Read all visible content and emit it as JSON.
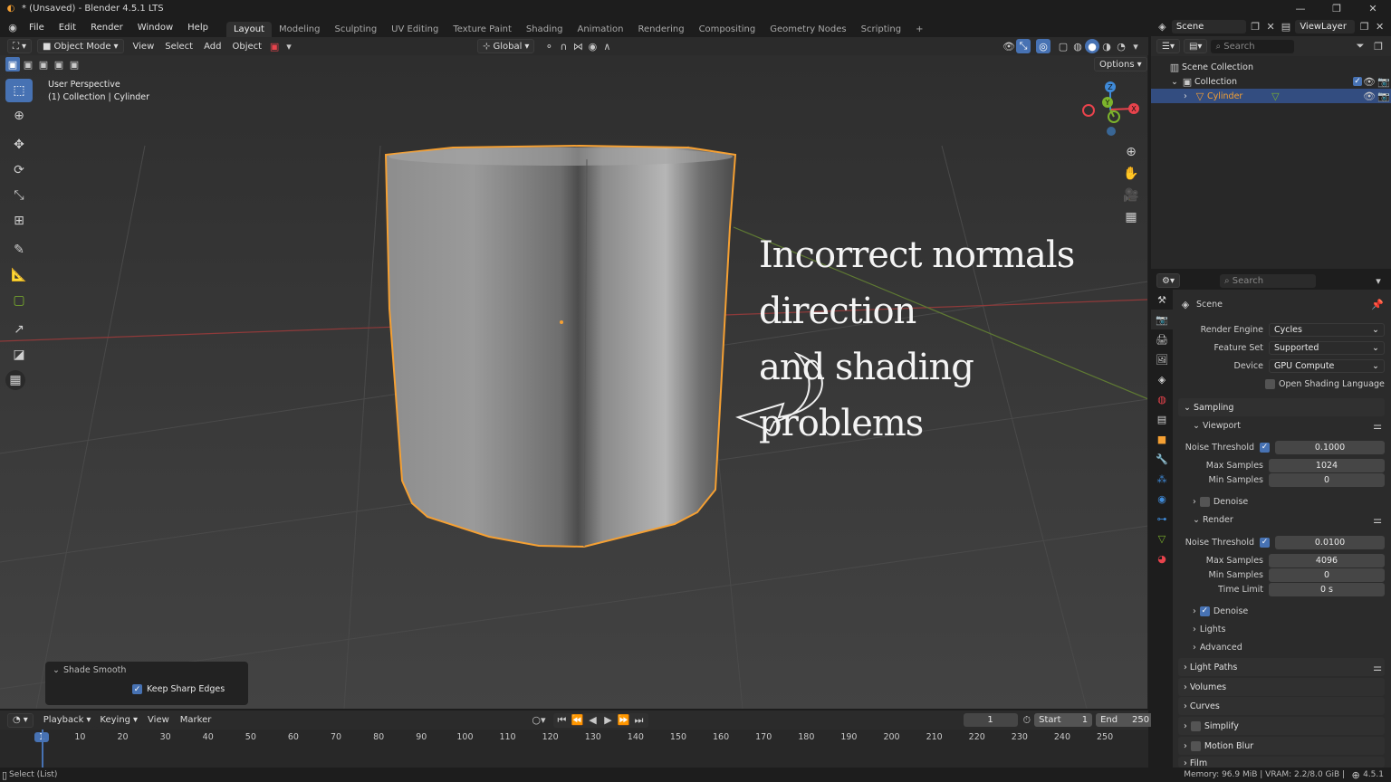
{
  "titlebar": {
    "title": "* (Unsaved) - Blender 4.5.1 LTS"
  },
  "menu": [
    "File",
    "Edit",
    "Render",
    "Window",
    "Help"
  ],
  "workspaces": [
    "Layout",
    "Modeling",
    "Sculpting",
    "UV Editing",
    "Texture Paint",
    "Shading",
    "Animation",
    "Rendering",
    "Compositing",
    "Geometry Nodes",
    "Scripting"
  ],
  "active_workspace": "Layout",
  "scene_selector": {
    "scene": "Scene",
    "view_layer": "ViewLayer"
  },
  "viewport_header": {
    "mode": "Object Mode",
    "menus": [
      "View",
      "Select",
      "Add",
      "Object"
    ],
    "orientation": "Global",
    "options": "Options"
  },
  "viewport": {
    "perspective": "User Perspective",
    "context": "(1) Collection | Cylinder",
    "annotation_line1": "Incorrect normals direction",
    "annotation_line2": "and shading problems"
  },
  "operator_panel": {
    "title": "Shade Smooth",
    "option_label": "Keep Sharp Edges",
    "option_checked": true
  },
  "timeline": {
    "menus": [
      "Playback",
      "Keying",
      "View",
      "Marker"
    ],
    "current_frame": "1",
    "start_label": "Start",
    "start": "1",
    "end_label": "End",
    "end": "250",
    "ticks": [
      "1",
      "10",
      "20",
      "30",
      "40",
      "50",
      "60",
      "70",
      "80",
      "90",
      "100",
      "110",
      "120",
      "130",
      "140",
      "150",
      "160",
      "170",
      "180",
      "190",
      "200",
      "210",
      "220",
      "230",
      "240",
      "250"
    ]
  },
  "statusbar": {
    "left": "Select (List)",
    "right": "Memory: 96.9 MiB | VRAM: 2.2/8.0 GiB |",
    "version": "4.5.1"
  },
  "outliner": {
    "search_placeholder": "Search",
    "root": "Scene Collection",
    "collection": "Collection",
    "object": "Cylinder"
  },
  "properties": {
    "search_placeholder": "Search",
    "context": "Scene",
    "render_engine_label": "Render Engine",
    "render_engine": "Cycles",
    "feature_set_label": "Feature Set",
    "feature_set": "Supported",
    "device_label": "Device",
    "device": "GPU Compute",
    "osl_label": "Open Shading Language",
    "sampling": "Sampling",
    "viewport_sub": "Viewport",
    "vp_noise_label": "Noise Threshold",
    "vp_noise": "0.1000",
    "vp_max_label": "Max Samples",
    "vp_max": "1024",
    "vp_min_label": "Min Samples",
    "vp_min": "0",
    "vp_denoise": "Denoise",
    "render_sub": "Render",
    "r_noise_label": "Noise Threshold",
    "r_noise": "0.0100",
    "r_max_label": "Max Samples",
    "r_max": "4096",
    "r_min_label": "Min Samples",
    "r_min": "0",
    "r_time_label": "Time Limit",
    "r_time": "0 s",
    "r_denoise": "Denoise",
    "lights": "Lights",
    "advanced": "Advanced",
    "light_paths": "Light Paths",
    "volumes": "Volumes",
    "curves": "Curves",
    "simplify": "Simplify",
    "motion_blur": "Motion Blur",
    "film": "Film"
  },
  "colors": {
    "accent": "#4772b3",
    "selection": "#f5a033",
    "axis_x": "#e8434c",
    "axis_y": "#7cb32c",
    "axis_z": "#3f8ad8"
  }
}
